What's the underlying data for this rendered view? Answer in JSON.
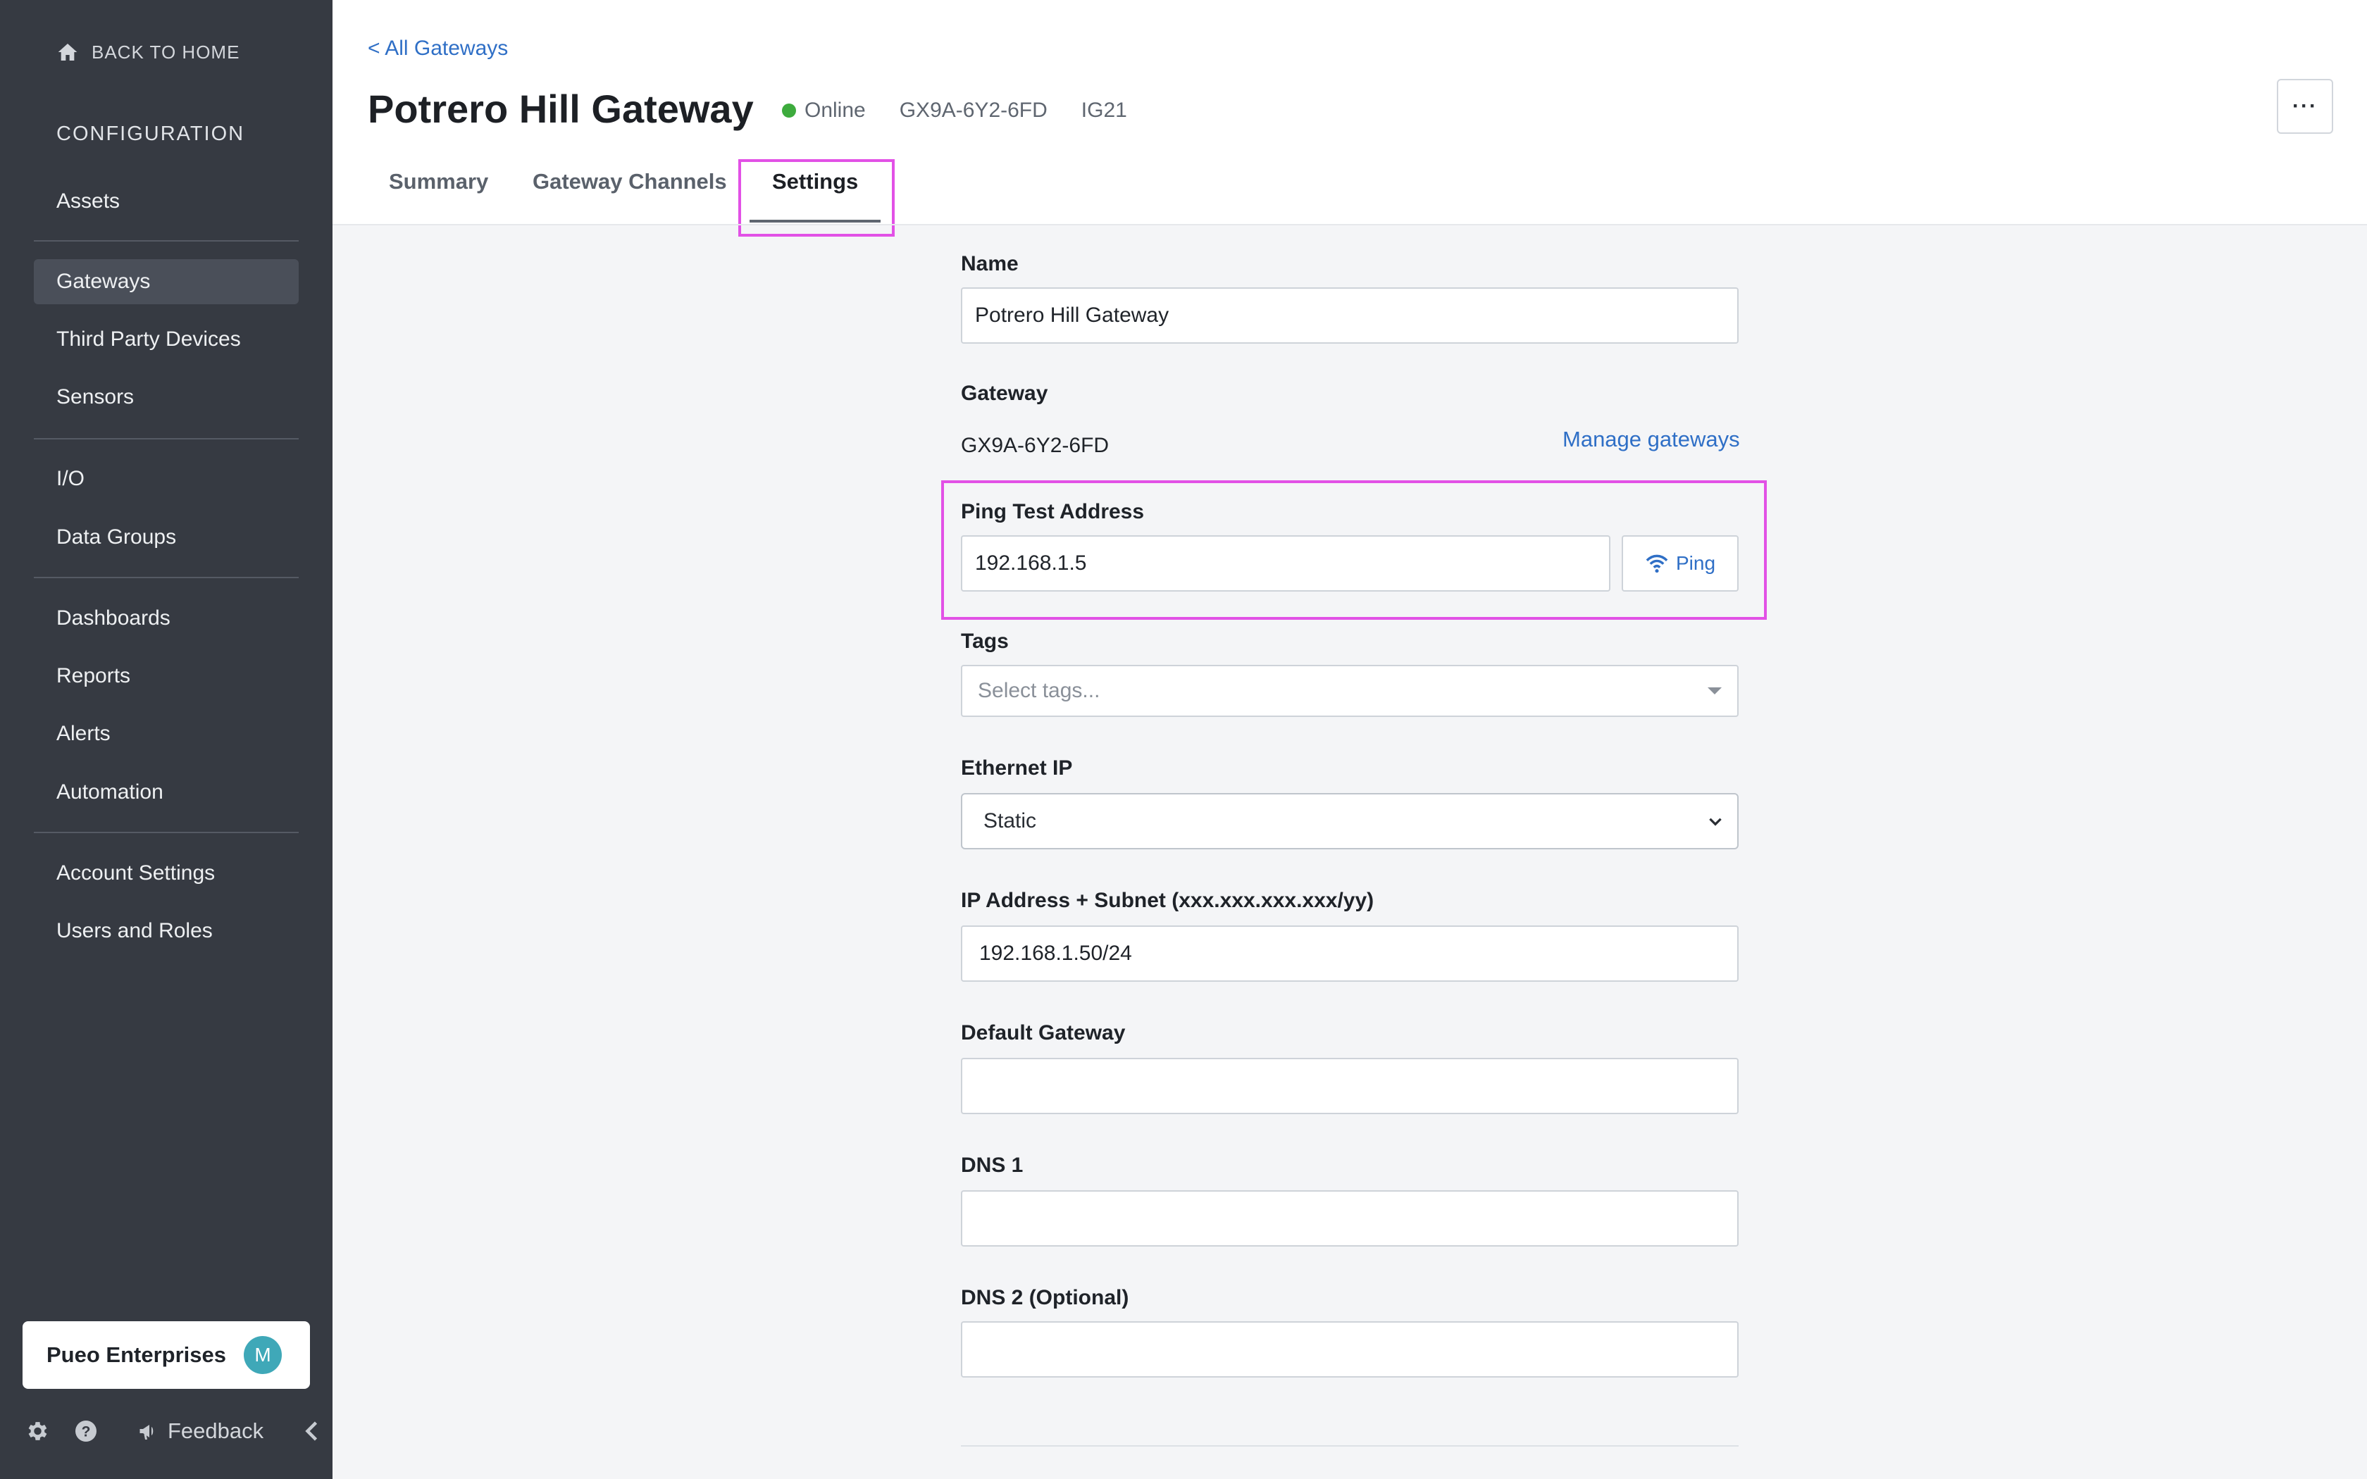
{
  "sidebar": {
    "back_home": "BACK TO HOME",
    "section_title": "CONFIGURATION",
    "items": [
      {
        "label": "Assets"
      },
      {
        "label": "Gateways",
        "active": true
      },
      {
        "label": "Third Party Devices"
      },
      {
        "label": "Sensors"
      },
      {
        "label": "I/O"
      },
      {
        "label": "Data Groups"
      },
      {
        "label": "Dashboards"
      },
      {
        "label": "Reports"
      },
      {
        "label": "Alerts"
      },
      {
        "label": "Automation"
      },
      {
        "label": "Account Settings"
      },
      {
        "label": "Users and Roles"
      }
    ],
    "org": {
      "name": "Pueo Enterprises",
      "avatar_initial": "M"
    },
    "footer": {
      "feedback": "Feedback",
      "icons": [
        "gear-icon",
        "help-icon",
        "megaphone-icon",
        "chevron-left-icon"
      ]
    }
  },
  "header": {
    "breadcrumb": "< All Gateways",
    "title": "Potrero Hill Gateway",
    "status": "Online",
    "serial": "GX9A-6Y2-6FD",
    "model": "IG21",
    "more_label": "···",
    "tabs": [
      {
        "label": "Summary"
      },
      {
        "label": "Gateway Channels"
      },
      {
        "label": "Settings",
        "active": true
      }
    ]
  },
  "form": {
    "name": {
      "label": "Name",
      "value": "Potrero Hill Gateway"
    },
    "gateway": {
      "label": "Gateway",
      "value": "GX9A-6Y2-6FD",
      "link": "Manage gateways"
    },
    "ping": {
      "label": "Ping Test Address",
      "value": "192.168.1.5",
      "button": "Ping"
    },
    "tags": {
      "label": "Tags",
      "placeholder": "Select tags..."
    },
    "ethernet_ip": {
      "label": "Ethernet IP",
      "value": "Static"
    },
    "ip_subnet": {
      "label": "IP Address + Subnet (xxx.xxx.xxx.xxx/yy)",
      "value": "192.168.1.50/24"
    },
    "default_gateway": {
      "label": "Default Gateway",
      "value": ""
    },
    "dns1": {
      "label": "DNS 1",
      "value": ""
    },
    "dns2": {
      "label": "DNS 2 (Optional)",
      "value": ""
    }
  },
  "colors": {
    "sidebar_bg": "#363a42",
    "accent_link": "#2f6fc6",
    "highlight": "#e251e6",
    "status_online": "#3dab3d",
    "avatar_bg": "#3fa8b8"
  }
}
